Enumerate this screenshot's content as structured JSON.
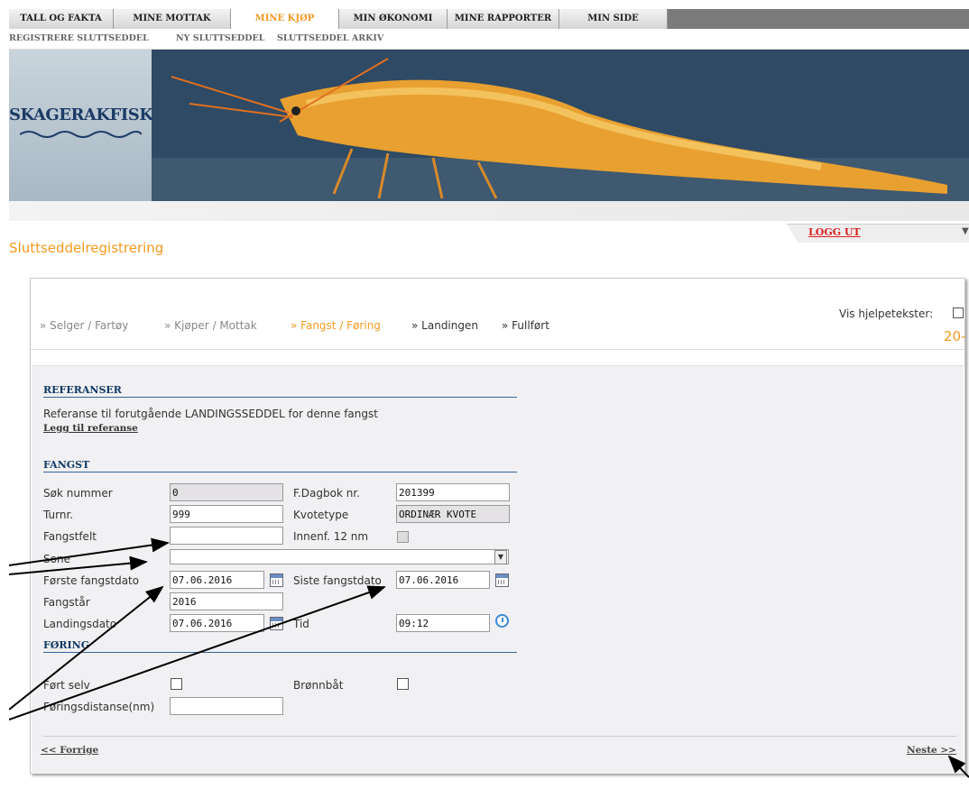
{
  "topnav": {
    "tabs": [
      "TALL OG FAKTA",
      "MINE MOTTAK",
      "MINE KJØP",
      "MIN ØKONOMI",
      "MINE RAPPORTER",
      "MIN SIDE"
    ]
  },
  "subnav": {
    "items": [
      "REGISTRERE SLUTTSEDDEL",
      "NY SLUTTSEDDEL",
      "SLUTTSEDDEL ARKIV"
    ]
  },
  "banner": {
    "logo_text": "SKAGERAKFISK"
  },
  "logout": "LOGG UT",
  "page_title": "Sluttseddelregistrering",
  "steps": [
    "Selger / Fartøy",
    "Kjøper / Mottak",
    "Fangst / Føring",
    "Landingen",
    "Fullført"
  ],
  "step_sep": "»",
  "help_label": "Vis hjelpetekster:",
  "year_fragment": "20-",
  "referanser": {
    "title": "REFERANSER",
    "text": "Referanse til forutgående LANDINGSSEDDEL for denne fangst",
    "link": "Legg til referanse"
  },
  "fangst": {
    "title": "FANGST",
    "labels": {
      "sok_nummer": "Søk nummer",
      "f_dagbok": "F.Dagbok nr.",
      "turnr": "Turnr.",
      "kvotetype": "Kvotetype",
      "fangstfelt": "Fangstfelt",
      "innenf": "Innenf. 12 nm",
      "sone": "Sone",
      "forste": "Første fangstdato",
      "siste": "Siste fangstdato",
      "fangstar": "Fangstår",
      "landingsdato": "Landingsdato",
      "tid": "Tid"
    },
    "values": {
      "sok_nummer": "0",
      "f_dagbok": "201399",
      "turnr": "999",
      "kvotetype": "ORDINÆR KVOTE",
      "fangstfelt": "",
      "sone": "",
      "forste": "07.06.2016",
      "siste": "07.06.2016",
      "fangstar": "2016",
      "landingsdato": "07.06.2016",
      "tid": "09:12"
    }
  },
  "foring": {
    "title": "FØRING",
    "labels": {
      "fort_selv": "Ført selv",
      "bronnbat": "Brønnbåt",
      "distanse": "Føringsdistanse(nm)"
    },
    "values": {
      "distanse": ""
    }
  },
  "footer": {
    "prev": "<< Forrige",
    "next": "Neste >>"
  },
  "colors": {
    "accent": "#f29a20",
    "section": "#0f3a66",
    "logout": "#d22222"
  }
}
